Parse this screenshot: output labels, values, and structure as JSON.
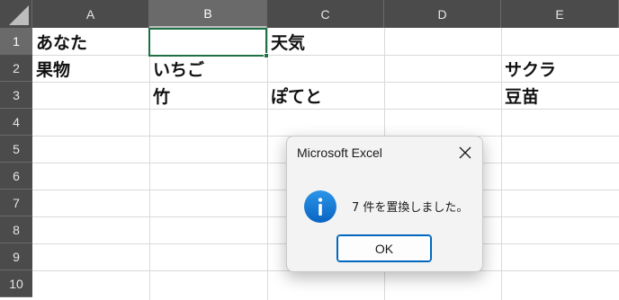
{
  "sheet": {
    "columns": [
      "A",
      "B",
      "C",
      "D",
      "E"
    ],
    "rows": [
      "1",
      "2",
      "3",
      "4",
      "5",
      "6",
      "7",
      "8",
      "9",
      "10"
    ],
    "cells": {
      "A1": "あなた",
      "C1": "天気",
      "A2": "果物",
      "B2": "いちご",
      "E2": "サクラ",
      "B3": "竹",
      "C3": "ぽてと",
      "E3": "豆苗"
    },
    "active_cell": "B1"
  },
  "dialog": {
    "title": "Microsoft Excel",
    "icon": "info-icon",
    "message": "7 件を置換しました。",
    "ok_label": "OK"
  },
  "colors": {
    "header_bg": "#4b4b4b",
    "header_selected_bg": "#6a6a6a",
    "active_cell_border": "#1e7145",
    "info_icon": "#0a78d4",
    "ok_border": "#0067c0"
  }
}
